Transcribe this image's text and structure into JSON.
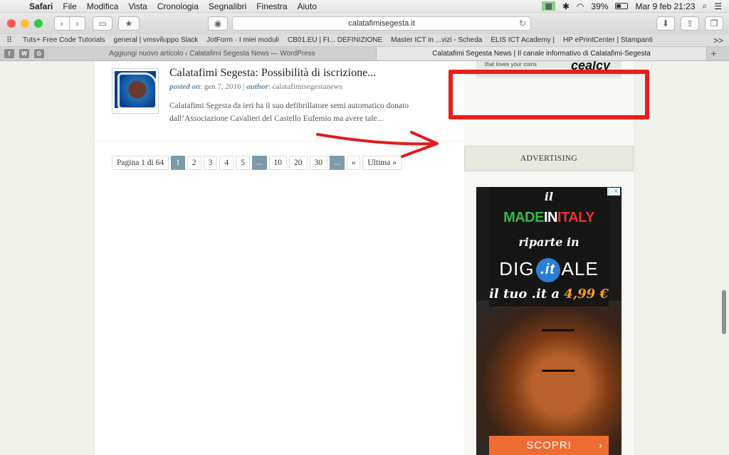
{
  "menubar": {
    "apple_icon": "",
    "app": "Safari",
    "items": [
      "File",
      "Modifica",
      "Vista",
      "Cronologia",
      "Segnalibri",
      "Finestra",
      "Aiuto"
    ],
    "battery": "39%",
    "datetime": "Mar 9 feb  21:23"
  },
  "toolbar": {
    "address": "calatafimisegesta.it",
    "reload_icon": "↻",
    "back_icon": "‹",
    "forward_icon": "›",
    "sidebar_icon": "▭",
    "bookmark_icon": "★",
    "shield_icon": "◉",
    "download_icon": "⬇",
    "share_icon": "⇪",
    "tabs_icon": "❐"
  },
  "bookmarks": {
    "grid_icon": "⠿",
    "items": [
      "Tuts+ Free Code Tutorials",
      "general | vmsviluppo Slack",
      "JotForm · I miei moduli",
      "CB01.EU | FI... DEFINIZIONE",
      "Master ICT in ...vizi - Scheda",
      "ELIS ICT Academy |",
      "HP ePrintCenter | Stampanti"
    ],
    "more": ">>"
  },
  "tabs": {
    "pinned": [
      "f",
      "W",
      "G"
    ],
    "items": [
      {
        "label": "Aggiungi nuovo articolo ‹ Calatafimi Segesta News — WordPress"
      },
      {
        "label": "Calatafimi Segesta News | Il canale informativo di Calatafimi-Segesta"
      }
    ],
    "new_tab": "+"
  },
  "post": {
    "title": "Calatafimi Segesta: Possibilità di iscrizione...",
    "posted_on_label": "posted on",
    "date": "gen 7, 2016",
    "author_label": "author",
    "author": "calatafimisegestanews",
    "excerpt": "Calatafimi Segesta da ieri ha il suo defibrillatore semi automatico donato dall’Associazione Cavalieri del Castello Eufemio ma avere tale..."
  },
  "pagination": {
    "info": "Pagina 1 di 64",
    "current": "1",
    "pages": [
      "2",
      "3",
      "4",
      "5"
    ],
    "dots1": "...",
    "far_pages": [
      "10",
      "20",
      "30"
    ],
    "dots2": "...",
    "next": "»",
    "last": "Ultima »"
  },
  "sidebar": {
    "ad_top_tagline": "that loves your coins",
    "ad_top_logo": "cealcy",
    "advertising_title": "ADVERTISING",
    "banner": {
      "line1": "il",
      "made_1": "MADE",
      "made_2": "IN",
      "made_3": "ITALY",
      "line3": "riparte in",
      "dig": "DIG",
      "it": ".it",
      "ale": "ALE",
      "tuo": "il tuo .it a ",
      "price": "4,99 €",
      "cta": "SCOPRI",
      "cta_chevron": "›",
      "adchoices": "▷✕"
    }
  },
  "colors": {
    "highlight": "#ee1c1c",
    "pagination_active": "#7e9aa8",
    "cta": "#ef6d33"
  }
}
